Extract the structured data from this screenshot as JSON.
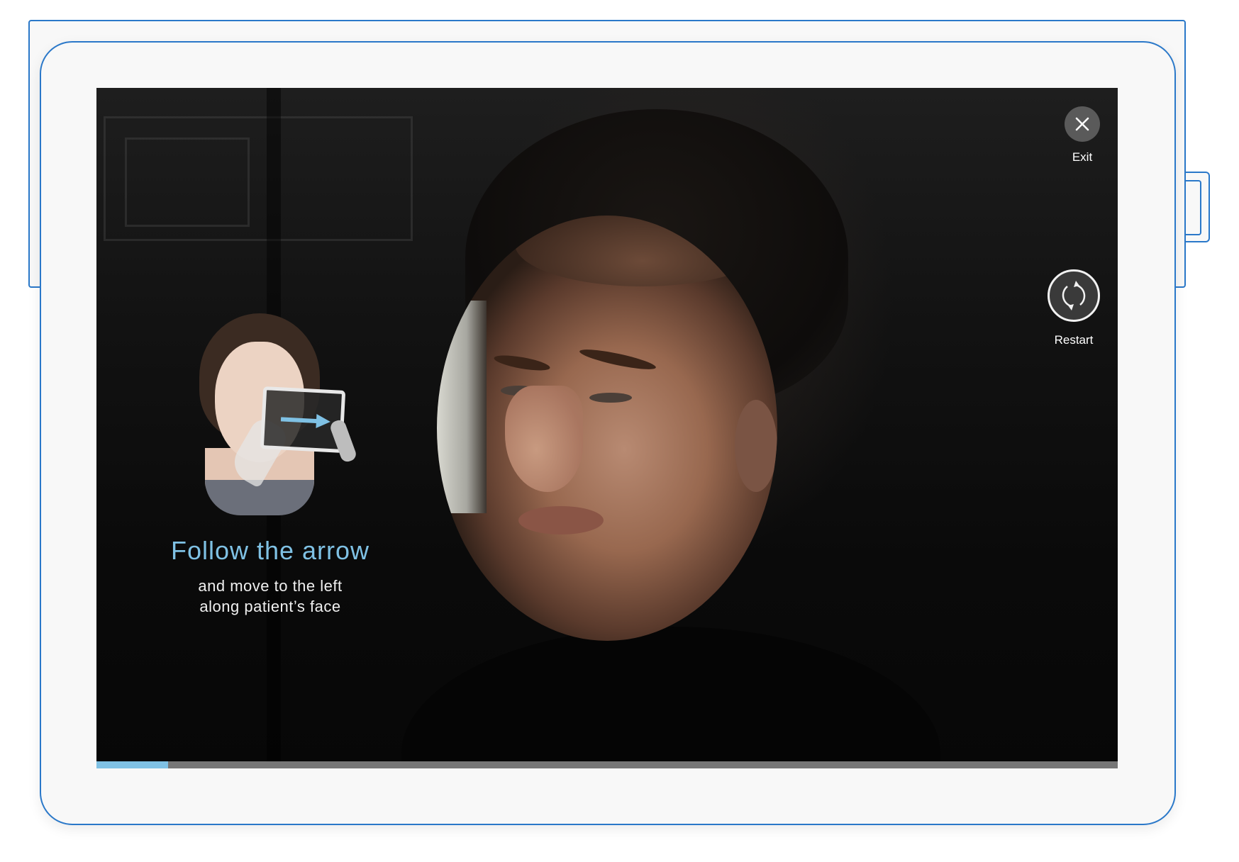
{
  "colors": {
    "accent": "#7fc1e4",
    "device_outline": "#2a78c9",
    "progress_track": "#777777"
  },
  "instruction": {
    "title": "Follow the arrow",
    "line1": "and move to the left",
    "line2": "along patient’s face",
    "arrow_direction": "right"
  },
  "controls": {
    "exit_label": "Exit",
    "exit_icon": "close-icon",
    "restart_label": "Restart",
    "restart_icon": "refresh-icon"
  },
  "progress": {
    "fraction": 0.07
  }
}
